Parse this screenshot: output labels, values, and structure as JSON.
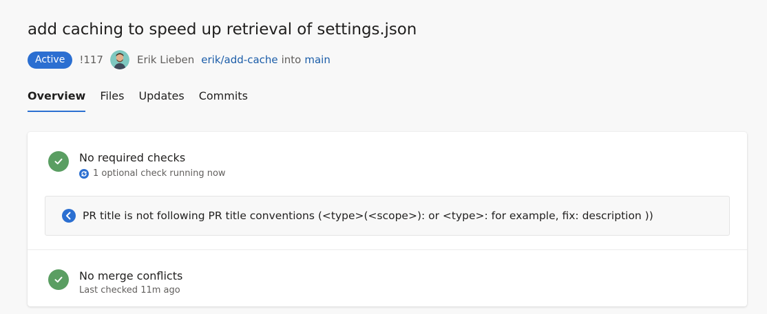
{
  "pr": {
    "title": "add caching to speed up retrieval of settings.json",
    "status": "Active",
    "id": "!117",
    "author": "Erik Lieben",
    "source_branch": "erik/add-cache",
    "into_word": "into",
    "target_branch": "main"
  },
  "tabs": [
    "Overview",
    "Files",
    "Updates",
    "Commits"
  ],
  "checks": {
    "required": {
      "title": "No required checks",
      "subtitle": "1 optional check running now"
    },
    "notice": "PR title is not following PR title conventions (<type>(<scope>): or <type>: for example, fix: description ))",
    "merge": {
      "title": "No merge conflicts",
      "subtitle": "Last checked 11m ago"
    }
  },
  "colors": {
    "accent": "#2b6fd1",
    "success": "#5a9e62",
    "link": "#1a5ca8"
  }
}
